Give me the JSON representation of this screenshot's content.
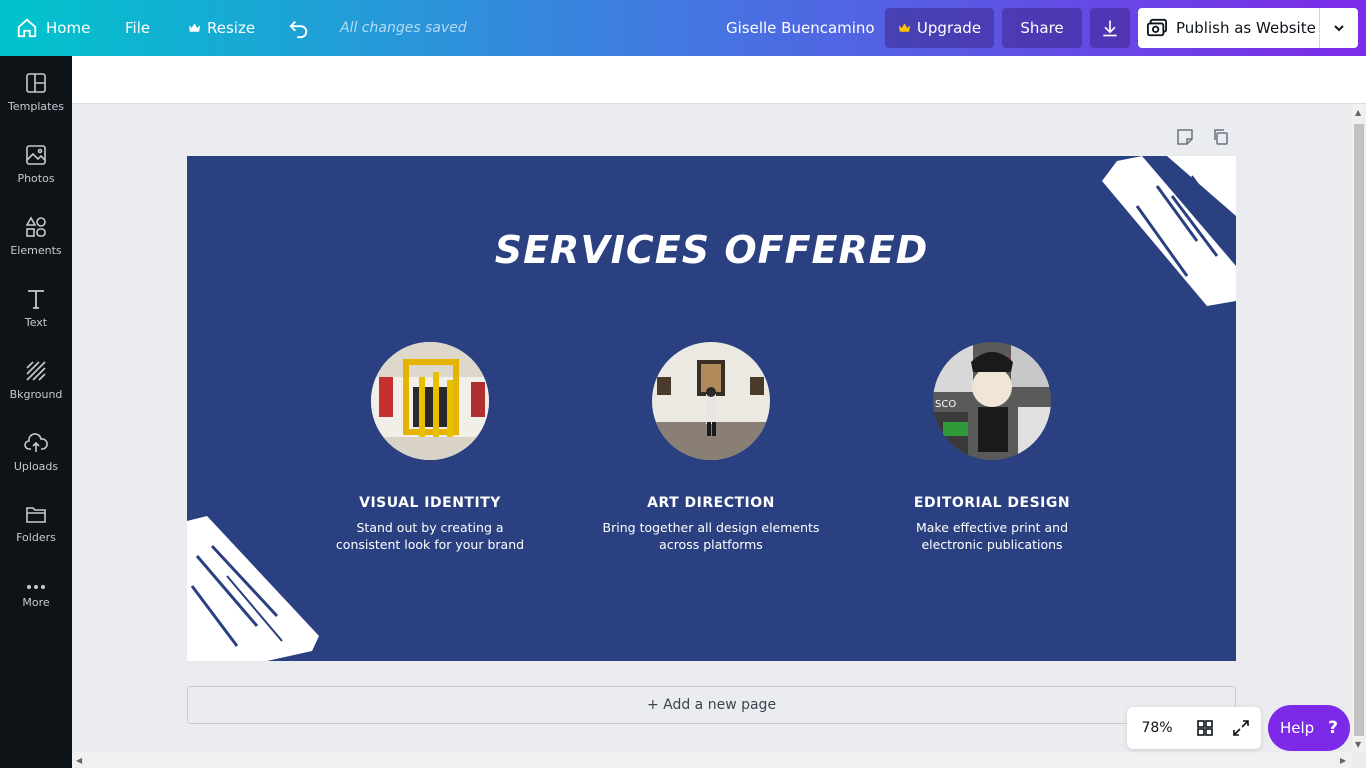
{
  "topbar": {
    "home_label": "Home",
    "file_label": "File",
    "resize_label": "Resize",
    "saved_status": "All changes saved",
    "user_name": "Giselle Buencamino",
    "upgrade_label": "Upgrade",
    "share_label": "Share",
    "publish_label": "Publish as Website"
  },
  "sidebar": {
    "items": [
      {
        "label": "Templates",
        "icon": "templates-icon"
      },
      {
        "label": "Photos",
        "icon": "photos-icon"
      },
      {
        "label": "Elements",
        "icon": "elements-icon"
      },
      {
        "label": "Text",
        "icon": "text-icon"
      },
      {
        "label": "Bkground",
        "icon": "background-icon"
      },
      {
        "label": "Uploads",
        "icon": "uploads-icon"
      },
      {
        "label": "Folders",
        "icon": "folders-icon"
      },
      {
        "label": "More",
        "icon": "more-icon"
      }
    ]
  },
  "design": {
    "title": "SERVICES OFFERED",
    "background_color": "#2a4080",
    "services": [
      {
        "name": "VISUAL IDENTITY",
        "desc_line1": "Stand out by creating a",
        "desc_line2": "consistent look for your brand",
        "image": "gallery-yellow-sculpture"
      },
      {
        "name": "ART DIRECTION",
        "desc_line1": "Bring together all design elements",
        "desc_line2": "across platforms",
        "image": "gallery-visitor-paintings"
      },
      {
        "name": "EDITORIAL DESIGN",
        "desc_line1": "Make effective print and",
        "desc_line2": "electronic publications",
        "image": "street-art-collage"
      }
    ]
  },
  "add_page_label": "+ Add a new page",
  "zoom": {
    "value": "78%"
  },
  "help": {
    "label": "Help",
    "symbol": "?"
  },
  "colors": {
    "accent_purple": "#7d2ae8",
    "accent_teal": "#00c4cc",
    "sidebar_bg": "#0e1318"
  }
}
